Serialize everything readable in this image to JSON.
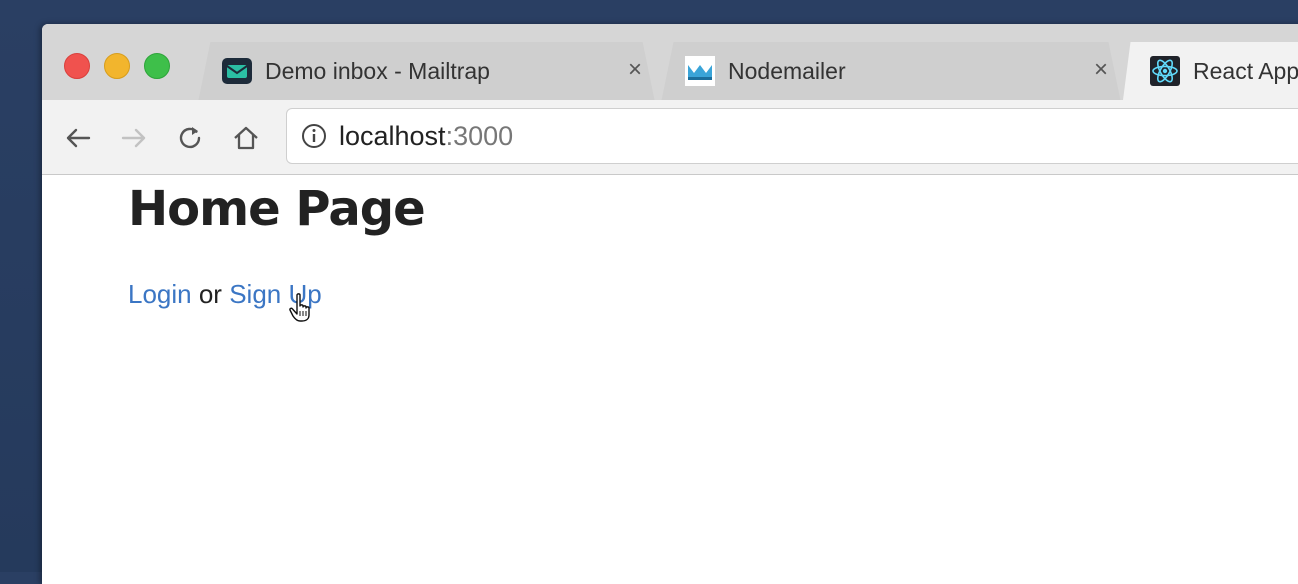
{
  "browser": {
    "tabs": [
      {
        "title": "Demo inbox - Mailtrap",
        "close": "×",
        "icon": "mailtrap-icon"
      },
      {
        "title": "Nodemailer",
        "close": "×",
        "icon": "nodemailer-icon"
      },
      {
        "title": "React App",
        "icon": "react-icon"
      }
    ],
    "address": {
      "host": "localhost",
      "port": ":3000"
    }
  },
  "page": {
    "heading": "Home Page",
    "login_link": "Login",
    "or_text": " or ",
    "signup_link": "Sign Up"
  },
  "colors": {
    "link": "#3b76c4",
    "traffic_red": "#f0524e",
    "traffic_yellow": "#f2b52d",
    "traffic_green": "#3ebf4a"
  }
}
